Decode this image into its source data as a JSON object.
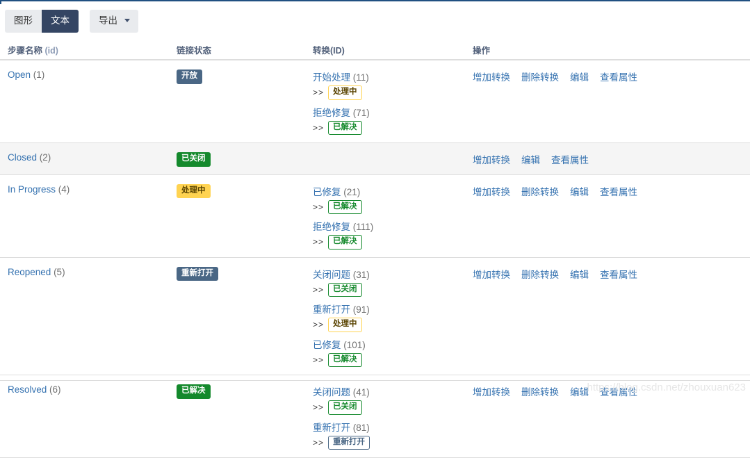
{
  "toolbar": {
    "diagram_label": "图形",
    "text_label": "文本",
    "export_label": "导出",
    "caret_icon": "chevron-down-icon"
  },
  "table": {
    "headers": {
      "step_name": "步骤名称",
      "step_name_id": "(id)",
      "linked_status": "链接状态",
      "transitions": "转换(ID)",
      "operations": "操作"
    },
    "rows": [
      {
        "name": "Open",
        "id": "(1)",
        "status": "开放",
        "status_style": "lz-blue",
        "shaded": false,
        "transitions": [
          {
            "label": "开始处理",
            "id": "(11)",
            "arrow": ">>",
            "target": "处理中",
            "target_style": "ch-yellow"
          },
          {
            "label": "拒绝修复",
            "id": "(71)",
            "arrow": ">>",
            "target": "已解决",
            "target_style": "ch-green"
          }
        ],
        "operations": [
          "增加转换",
          "删除转换",
          "编辑",
          "查看属性"
        ]
      },
      {
        "name": "Closed",
        "id": "(2)",
        "status": "已关闭",
        "status_style": "lz-green",
        "shaded": true,
        "transitions": [],
        "operations": [
          "增加转换",
          "编辑",
          "查看属性"
        ]
      },
      {
        "name": "In Progress",
        "id": "(4)",
        "status": "处理中",
        "status_style": "lz-yellow",
        "shaded": false,
        "transitions": [
          {
            "label": "已修复",
            "id": "(21)",
            "arrow": ">>",
            "target": "已解决",
            "target_style": "ch-green"
          },
          {
            "label": "拒绝修复",
            "id": "(111)",
            "arrow": ">>",
            "target": "已解决",
            "target_style": "ch-green"
          }
        ],
        "operations": [
          "增加转换",
          "删除转换",
          "编辑",
          "查看属性"
        ]
      },
      {
        "name": "Reopened",
        "id": "(5)",
        "status": "重新打开",
        "status_style": "lz-blue",
        "shaded": false,
        "transitions": [
          {
            "label": "关闭问题",
            "id": "(31)",
            "arrow": ">>",
            "target": "已关闭",
            "target_style": "ch-green"
          },
          {
            "label": "重新打开",
            "id": "(91)",
            "arrow": ">>",
            "target": "处理中",
            "target_style": "ch-yellow"
          },
          {
            "label": "已修复",
            "id": "(101)",
            "arrow": ">>",
            "target": "已解决",
            "target_style": "ch-green"
          }
        ],
        "operations": [
          "增加转换",
          "删除转换",
          "编辑",
          "查看属性"
        ]
      },
      {
        "name": "Resolved",
        "id": "(6)",
        "status": "已解决",
        "status_style": "lz-green",
        "shaded": false,
        "transitions": [
          {
            "label": "关闭问题",
            "id": "(41)",
            "arrow": ">>",
            "target": "已关闭",
            "target_style": "ch-green"
          },
          {
            "label": "重新打开",
            "id": "(81)",
            "arrow": ">>",
            "target": "重新打开",
            "target_style": "ch-blue"
          }
        ],
        "operations": [
          "增加转换",
          "删除转换",
          "编辑",
          "查看属性"
        ]
      }
    ]
  },
  "watermark": "https://blog.csdn.net/zhouxuan623",
  "colors": {
    "link": "#3572b0",
    "status_blue": "#4a6785",
    "status_green": "#14892c",
    "status_yellow": "#ffd351",
    "active_button": "#344563",
    "top_rule": "#205081"
  }
}
